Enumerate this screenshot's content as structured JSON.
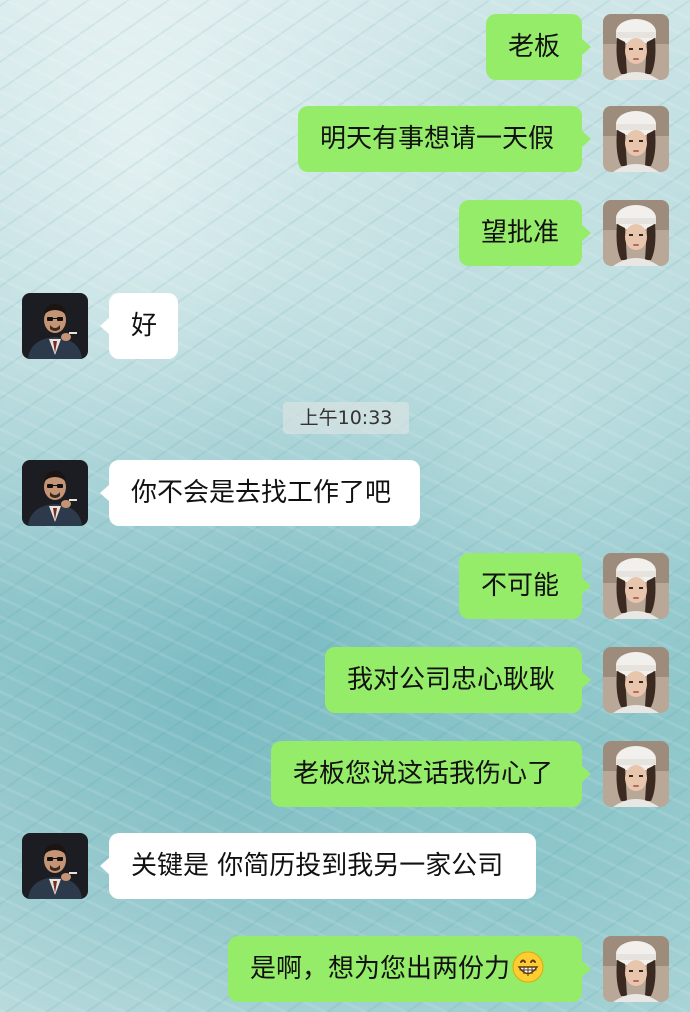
{
  "chat": {
    "messages": [
      {
        "text": "老板"
      },
      {
        "text": "明天有事想请一天假"
      },
      {
        "text": "望批准"
      },
      {
        "text": "好"
      },
      {
        "text": "你不会是去找工作了吧"
      },
      {
        "text": "不可能"
      },
      {
        "text": "我对公司忠心耿耿"
      },
      {
        "text": "老板您说这话我伤心了"
      },
      {
        "text": "关键是 你简历投到我另一家公司"
      },
      {
        "text": "是啊，想为您出两份力"
      }
    ],
    "timestamp": "上午10:33",
    "emoji_icon": "grinning-face-emoji",
    "colors": {
      "my_bubble": "#95ec69",
      "other_bubble": "#ffffff",
      "background": "#a9d3d6"
    }
  }
}
